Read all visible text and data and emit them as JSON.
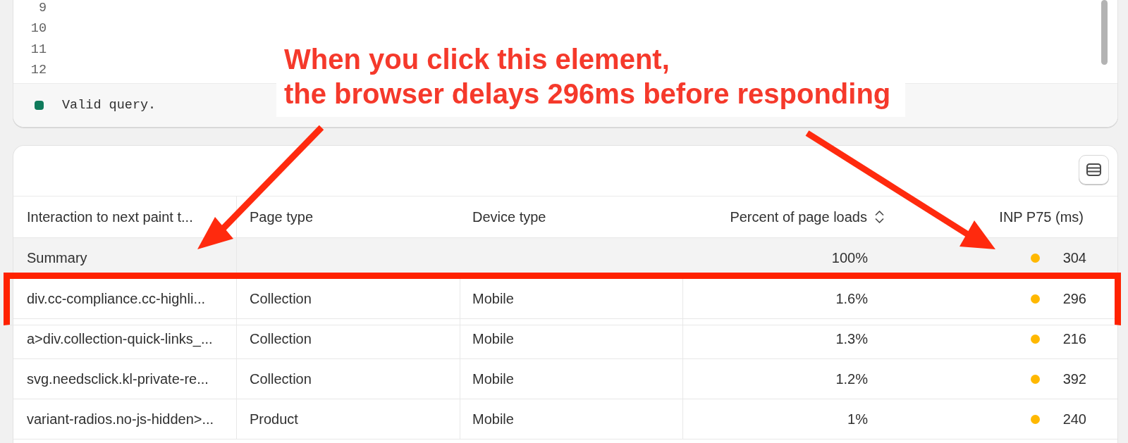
{
  "editor": {
    "line_numbers": [
      "9",
      "10",
      "11",
      "12"
    ],
    "status": {
      "text": "Valid query.",
      "valid": true
    }
  },
  "table": {
    "columns": [
      {
        "label": "Interaction to next paint t...",
        "sortable": false
      },
      {
        "label": "Page type",
        "sortable": false
      },
      {
        "label": "Device type",
        "sortable": false
      },
      {
        "label": "Percent of page loads",
        "sortable": true
      },
      {
        "label": "INP P75 (ms)",
        "sortable": false
      }
    ],
    "summary": {
      "label": "Summary",
      "percent": "100%",
      "inp": "304",
      "color": "#ffb800"
    },
    "rows": [
      {
        "target": "div.cc-compliance.cc-highli...",
        "page_type": "Collection",
        "device_type": "Mobile",
        "percent": "1.6%",
        "inp": "296",
        "color": "#ffb800",
        "highlighted": true
      },
      {
        "target": "a>div.collection-quick-links_...",
        "page_type": "Collection",
        "device_type": "Mobile",
        "percent": "1.3%",
        "inp": "216",
        "color": "#ffb800",
        "highlighted": false
      },
      {
        "target": "svg.needsclick.kl-private-re...",
        "page_type": "Collection",
        "device_type": "Mobile",
        "percent": "1.2%",
        "inp": "392",
        "color": "#ffb800",
        "highlighted": false
      },
      {
        "target": "variant-radios.no-js-hidden>...",
        "page_type": "Product",
        "device_type": "Mobile",
        "percent": "1%",
        "inp": "240",
        "color": "#ffb800",
        "highlighted": false
      }
    ]
  },
  "callout": {
    "lines": [
      "When you click this element,",
      "the browser delays 296ms before responding"
    ]
  }
}
